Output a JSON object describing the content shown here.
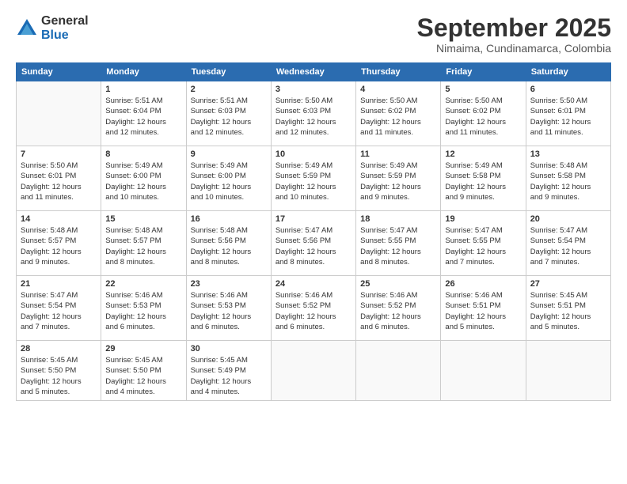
{
  "header": {
    "logo": {
      "general": "General",
      "blue": "Blue"
    },
    "title": "September 2025",
    "location": "Nimaima, Cundinamarca, Colombia"
  },
  "days_of_week": [
    "Sunday",
    "Monday",
    "Tuesday",
    "Wednesday",
    "Thursday",
    "Friday",
    "Saturday"
  ],
  "weeks": [
    [
      {
        "day": "",
        "info": ""
      },
      {
        "day": "1",
        "info": "Sunrise: 5:51 AM\nSunset: 6:04 PM\nDaylight: 12 hours\nand 12 minutes."
      },
      {
        "day": "2",
        "info": "Sunrise: 5:51 AM\nSunset: 6:03 PM\nDaylight: 12 hours\nand 12 minutes."
      },
      {
        "day": "3",
        "info": "Sunrise: 5:50 AM\nSunset: 6:03 PM\nDaylight: 12 hours\nand 12 minutes."
      },
      {
        "day": "4",
        "info": "Sunrise: 5:50 AM\nSunset: 6:02 PM\nDaylight: 12 hours\nand 11 minutes."
      },
      {
        "day": "5",
        "info": "Sunrise: 5:50 AM\nSunset: 6:02 PM\nDaylight: 12 hours\nand 11 minutes."
      },
      {
        "day": "6",
        "info": "Sunrise: 5:50 AM\nSunset: 6:01 PM\nDaylight: 12 hours\nand 11 minutes."
      }
    ],
    [
      {
        "day": "7",
        "info": "Sunrise: 5:50 AM\nSunset: 6:01 PM\nDaylight: 12 hours\nand 11 minutes."
      },
      {
        "day": "8",
        "info": "Sunrise: 5:49 AM\nSunset: 6:00 PM\nDaylight: 12 hours\nand 10 minutes."
      },
      {
        "day": "9",
        "info": "Sunrise: 5:49 AM\nSunset: 6:00 PM\nDaylight: 12 hours\nand 10 minutes."
      },
      {
        "day": "10",
        "info": "Sunrise: 5:49 AM\nSunset: 5:59 PM\nDaylight: 12 hours\nand 10 minutes."
      },
      {
        "day": "11",
        "info": "Sunrise: 5:49 AM\nSunset: 5:59 PM\nDaylight: 12 hours\nand 9 minutes."
      },
      {
        "day": "12",
        "info": "Sunrise: 5:49 AM\nSunset: 5:58 PM\nDaylight: 12 hours\nand 9 minutes."
      },
      {
        "day": "13",
        "info": "Sunrise: 5:48 AM\nSunset: 5:58 PM\nDaylight: 12 hours\nand 9 minutes."
      }
    ],
    [
      {
        "day": "14",
        "info": "Sunrise: 5:48 AM\nSunset: 5:57 PM\nDaylight: 12 hours\nand 9 minutes."
      },
      {
        "day": "15",
        "info": "Sunrise: 5:48 AM\nSunset: 5:57 PM\nDaylight: 12 hours\nand 8 minutes."
      },
      {
        "day": "16",
        "info": "Sunrise: 5:48 AM\nSunset: 5:56 PM\nDaylight: 12 hours\nand 8 minutes."
      },
      {
        "day": "17",
        "info": "Sunrise: 5:47 AM\nSunset: 5:56 PM\nDaylight: 12 hours\nand 8 minutes."
      },
      {
        "day": "18",
        "info": "Sunrise: 5:47 AM\nSunset: 5:55 PM\nDaylight: 12 hours\nand 8 minutes."
      },
      {
        "day": "19",
        "info": "Sunrise: 5:47 AM\nSunset: 5:55 PM\nDaylight: 12 hours\nand 7 minutes."
      },
      {
        "day": "20",
        "info": "Sunrise: 5:47 AM\nSunset: 5:54 PM\nDaylight: 12 hours\nand 7 minutes."
      }
    ],
    [
      {
        "day": "21",
        "info": "Sunrise: 5:47 AM\nSunset: 5:54 PM\nDaylight: 12 hours\nand 7 minutes."
      },
      {
        "day": "22",
        "info": "Sunrise: 5:46 AM\nSunset: 5:53 PM\nDaylight: 12 hours\nand 6 minutes."
      },
      {
        "day": "23",
        "info": "Sunrise: 5:46 AM\nSunset: 5:53 PM\nDaylight: 12 hours\nand 6 minutes."
      },
      {
        "day": "24",
        "info": "Sunrise: 5:46 AM\nSunset: 5:52 PM\nDaylight: 12 hours\nand 6 minutes."
      },
      {
        "day": "25",
        "info": "Sunrise: 5:46 AM\nSunset: 5:52 PM\nDaylight: 12 hours\nand 6 minutes."
      },
      {
        "day": "26",
        "info": "Sunrise: 5:46 AM\nSunset: 5:51 PM\nDaylight: 12 hours\nand 5 minutes."
      },
      {
        "day": "27",
        "info": "Sunrise: 5:45 AM\nSunset: 5:51 PM\nDaylight: 12 hours\nand 5 minutes."
      }
    ],
    [
      {
        "day": "28",
        "info": "Sunrise: 5:45 AM\nSunset: 5:50 PM\nDaylight: 12 hours\nand 5 minutes."
      },
      {
        "day": "29",
        "info": "Sunrise: 5:45 AM\nSunset: 5:50 PM\nDaylight: 12 hours\nand 4 minutes."
      },
      {
        "day": "30",
        "info": "Sunrise: 5:45 AM\nSunset: 5:49 PM\nDaylight: 12 hours\nand 4 minutes."
      },
      {
        "day": "",
        "info": ""
      },
      {
        "day": "",
        "info": ""
      },
      {
        "day": "",
        "info": ""
      },
      {
        "day": "",
        "info": ""
      }
    ]
  ]
}
